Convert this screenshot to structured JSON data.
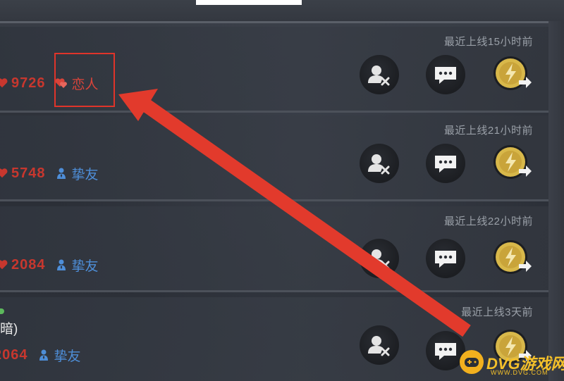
{
  "friends": [
    {
      "last_online": "最近上线15小时前",
      "intimacy": "9726",
      "relation": "恋人",
      "relation_kind": "lover"
    },
    {
      "last_online": "最近上线21小时前",
      "intimacy": "5748",
      "relation": "挚友",
      "relation_kind": "best-friend"
    },
    {
      "last_online": "最近上线22小时前",
      "intimacy": "2084",
      "relation": "挚友",
      "relation_kind": "best-friend"
    },
    {
      "last_online": "最近上线3天前",
      "name_fragment": "暗)",
      "intimacy": "2064",
      "relation": "挚友",
      "relation_kind": "best-friend"
    }
  ],
  "icons": {
    "intimacy": "heart-icon",
    "lover": "heart-lover-icon",
    "best_friend": "person-icon",
    "remove_friend": "remove-friend-icon",
    "chat": "chat-bubble-icon",
    "send_energy": "energy-coin-send-icon"
  },
  "colors": {
    "intimacy": "#c8372e",
    "best_friend": "#4e8ed8",
    "annotation": "#e0342a",
    "coin": "#d8b84a"
  },
  "watermark": {
    "brand": "DVG游戏网",
    "url": "WWW.DVG.COM"
  }
}
